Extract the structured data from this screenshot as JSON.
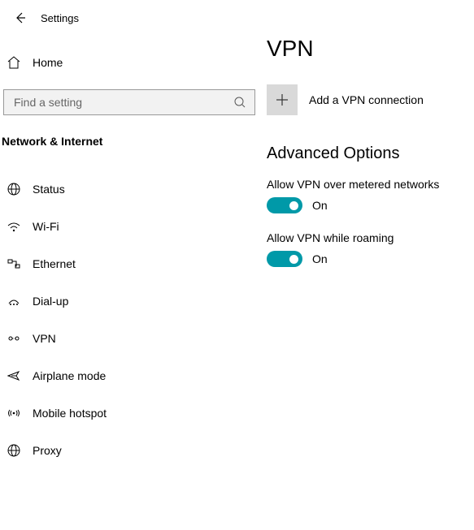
{
  "header": {
    "title": "Settings"
  },
  "home": {
    "label": "Home"
  },
  "search": {
    "placeholder": "Find a setting"
  },
  "category": "Network & Internet",
  "nav": {
    "status": "Status",
    "wifi": "Wi-Fi",
    "ethernet": "Ethernet",
    "dialup": "Dial-up",
    "vpn": "VPN",
    "airplane": "Airplane mode",
    "hotspot": "Mobile hotspot",
    "proxy": "Proxy"
  },
  "main": {
    "title": "VPN",
    "add_label": "Add a VPN connection",
    "advanced_title": "Advanced Options",
    "metered": {
      "label": "Allow VPN over metered networks",
      "state": "On"
    },
    "roaming": {
      "label": "Allow VPN while roaming",
      "state": "On"
    }
  }
}
